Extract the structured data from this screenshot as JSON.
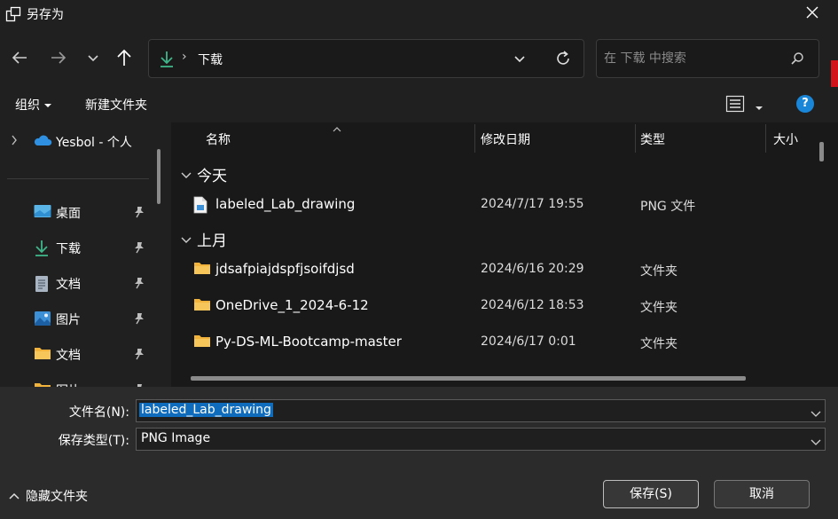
{
  "window": {
    "title": "另存为"
  },
  "nav": {
    "breadcrumb": "下载",
    "search_placeholder": "在 下载 中搜索"
  },
  "commands": {
    "organize": "组织",
    "new_folder": "新建文件夹",
    "help": "?"
  },
  "sidebar": {
    "top_item": "Yesbol - 个人",
    "items": [
      {
        "label": "桌面",
        "icon": "desktop-icon"
      },
      {
        "label": "下载",
        "icon": "download-icon"
      },
      {
        "label": "文档",
        "icon": "document-icon"
      },
      {
        "label": "图片",
        "icon": "picture-icon"
      },
      {
        "label": "文档",
        "icon": "folder-icon"
      },
      {
        "label": "图片",
        "icon": "folder-icon"
      }
    ]
  },
  "columns": {
    "name": "名称",
    "modified": "修改日期",
    "type": "类型",
    "size": "大小"
  },
  "groups": [
    {
      "label": "今天",
      "files": [
        {
          "name": "labeled_Lab_drawing",
          "date": "2024/7/17 19:55",
          "type": "PNG 文件",
          "icon": "png-file-icon"
        }
      ]
    },
    {
      "label": "上月",
      "files": [
        {
          "name": "jdsafpiajdspfjsoifdjsd",
          "date": "2024/6/16 20:29",
          "type": "文件夹",
          "icon": "folder-icon"
        },
        {
          "name": "OneDrive_1_2024-6-12",
          "date": "2024/6/12 18:53",
          "type": "文件夹",
          "icon": "folder-icon"
        },
        {
          "name": "Py-DS-ML-Bootcamp-master",
          "date": "2024/6/17 0:01",
          "type": "文件夹",
          "icon": "folder-icon"
        }
      ]
    }
  ],
  "form": {
    "filename_label": "文件名(N):",
    "filename_value": "labeled_Lab_drawing",
    "filetype_label": "保存类型(T):",
    "filetype_value": "PNG Image"
  },
  "footer": {
    "hide_folders": "隐藏文件夹",
    "save": "保存(S)",
    "cancel": "取消"
  },
  "colors": {
    "accent": "#0f6cbd",
    "folder": "#f2b33d",
    "download": "#3fb58a"
  }
}
